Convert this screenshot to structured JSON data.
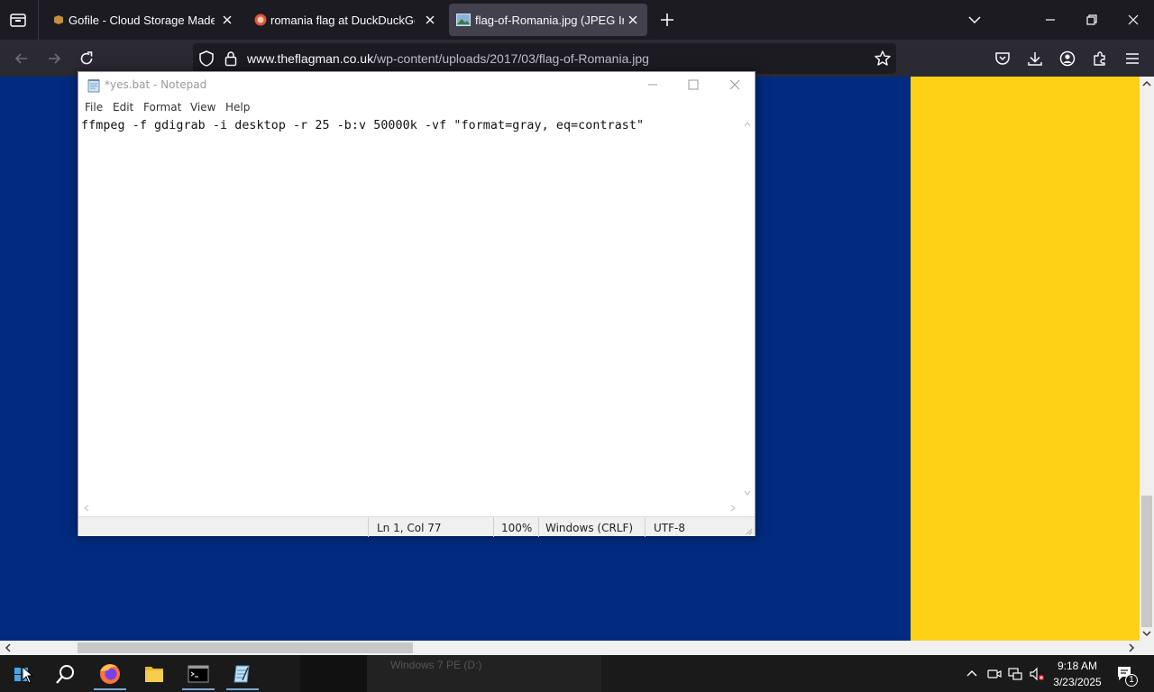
{
  "browser": {
    "tabs": [
      {
        "title": "Gofile - Cloud Storage Made Si",
        "active": false
      },
      {
        "title": "romania flag at DuckDuckGo",
        "active": false
      },
      {
        "title": "flag-of-Romania.jpg (JPEG Ima",
        "active": true
      }
    ],
    "url_host": "www.theflagman.co.uk",
    "url_path": "/wp-content/uploads/2017/03/flag-of-Romania.jpg"
  },
  "page": {
    "flag_colors": {
      "blue": "#002b7f",
      "yellow": "#fcd116"
    }
  },
  "notepad": {
    "title": "*yes.bat - Notepad",
    "menu": [
      "File",
      "Edit",
      "Format",
      "View",
      "Help"
    ],
    "text": "ffmpeg -f gdigrab -i desktop -r 25 -b:v 50000k -vf \"format=gray, eq=contrast\"",
    "status": {
      "position": "Ln 1, Col 77",
      "zoom": "100%",
      "line_ending": "Windows (CRLF)",
      "encoding": "UTF-8"
    }
  },
  "taskbar": {
    "time": "9:18 AM",
    "date": "3/23/2025",
    "notification_count": "1",
    "behind_text": "Windows 7 PE (D:)"
  }
}
